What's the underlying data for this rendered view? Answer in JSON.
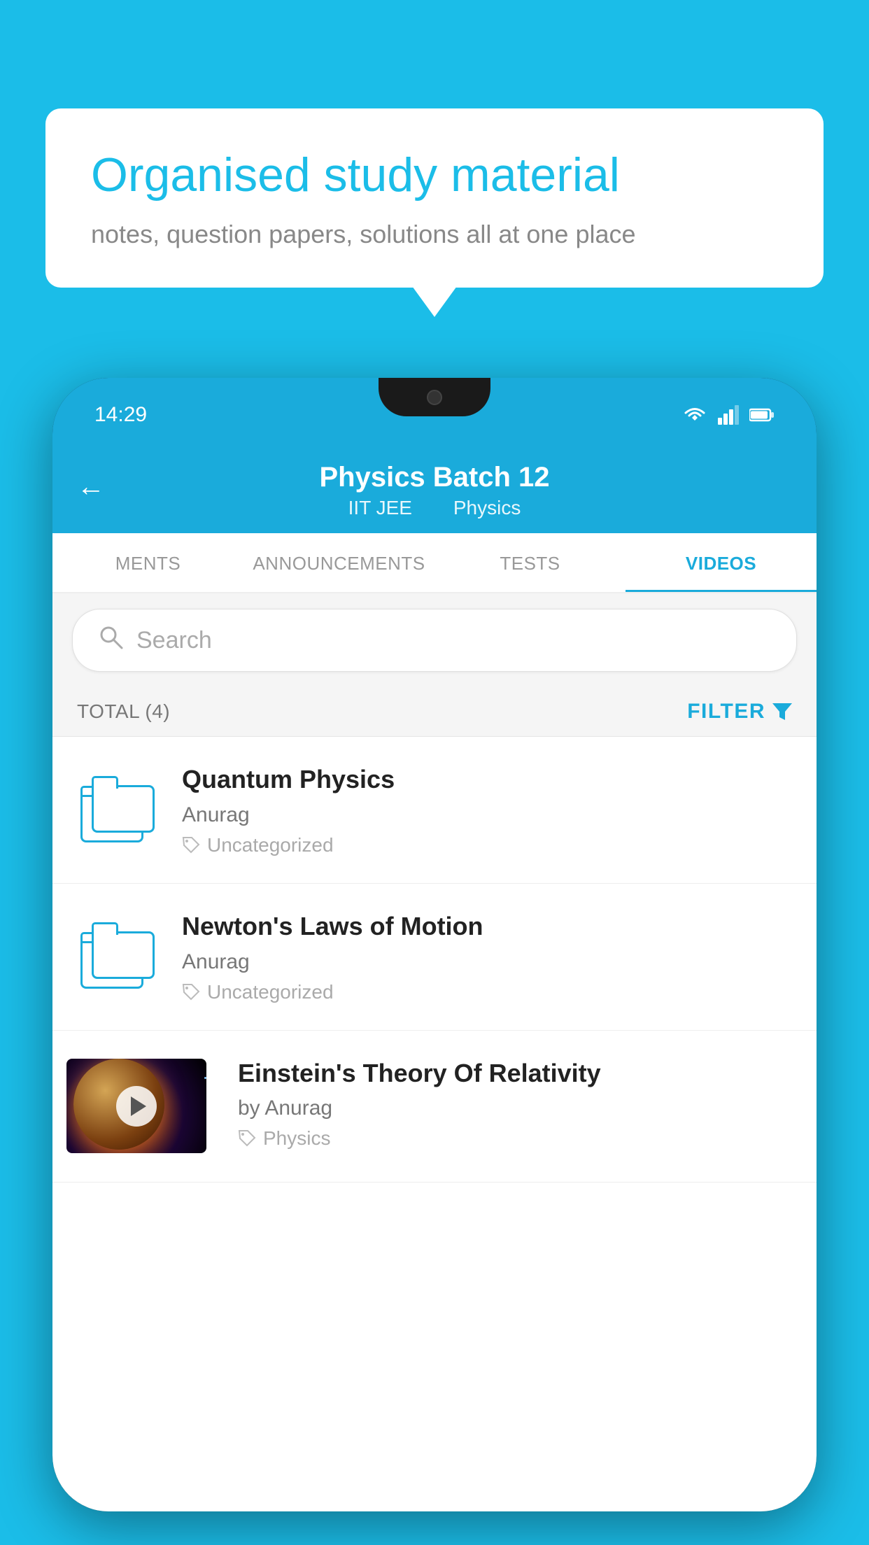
{
  "background": {
    "color": "#1bbde8"
  },
  "speech_bubble": {
    "title": "Organised study material",
    "subtitle": "notes, question papers, solutions all at one place"
  },
  "phone": {
    "status_bar": {
      "time": "14:29",
      "icons": [
        "wifi",
        "signal",
        "battery"
      ]
    },
    "header": {
      "back_label": "←",
      "title": "Physics Batch 12",
      "subtitle_1": "IIT JEE",
      "subtitle_2": "Physics"
    },
    "tabs": [
      {
        "label": "MENTS",
        "active": false
      },
      {
        "label": "ANNOUNCEMENTS",
        "active": false
      },
      {
        "label": "TESTS",
        "active": false
      },
      {
        "label": "VIDEOS",
        "active": true
      }
    ],
    "search": {
      "placeholder": "Search"
    },
    "filter_row": {
      "total_label": "TOTAL (4)",
      "filter_label": "FILTER"
    },
    "videos": [
      {
        "title": "Quantum Physics",
        "author": "Anurag",
        "tag": "Uncategorized",
        "type": "folder"
      },
      {
        "title": "Newton's Laws of Motion",
        "author": "Anurag",
        "tag": "Uncategorized",
        "type": "folder"
      },
      {
        "title": "Einstein's Theory Of Relativity",
        "author": "by Anurag",
        "tag": "Physics",
        "type": "video"
      }
    ]
  }
}
